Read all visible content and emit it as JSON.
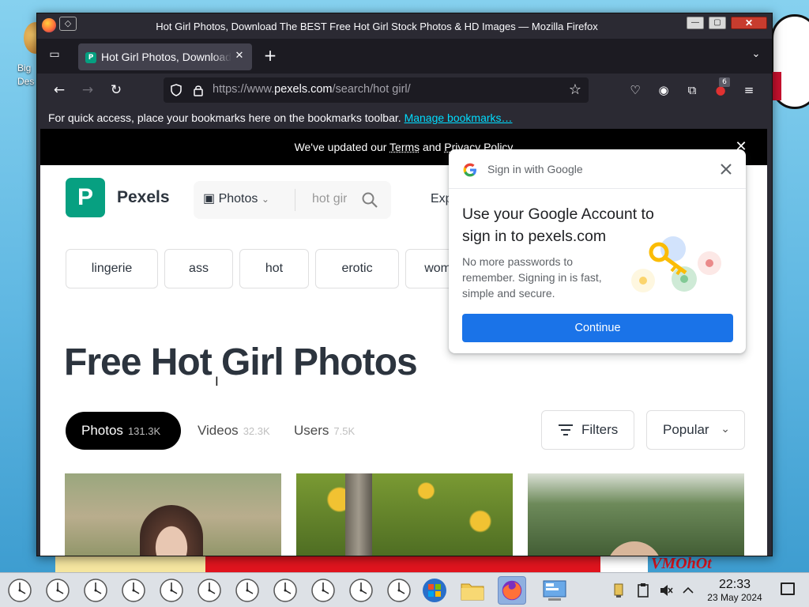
{
  "desktop": {
    "icon_label": "Big Des",
    "brand_text": "VMOhOt"
  },
  "window": {
    "title": "Hot Girl Photos, Download The BEST Free Hot Girl Stock Photos & HD Images — Mozilla Firefox",
    "buttons": {
      "minimize": "—",
      "maximize": "▢",
      "close": "✕"
    }
  },
  "tabs": [
    {
      "title": "Hot Girl Photos, Download The BEST Free",
      "favicon": "P"
    }
  ],
  "toolbar": {
    "url_prefix": "https://www.",
    "url_host": "pexels.com",
    "url_path": "/search/hot girl/",
    "extension_badge": "6"
  },
  "bookmarks_bar": {
    "message": "For quick access, place your bookmarks here on the bookmarks toolbar.",
    "link": "Manage bookmarks…"
  },
  "notice": {
    "prefix": "We've updated our ",
    "terms": "Terms",
    "and": " and ",
    "privacy": "Privacy Policy"
  },
  "site": {
    "logo_letter": "P",
    "logo_text": "Pexels",
    "search_type": "Photos",
    "search_query": "hot girl",
    "explore": "Explore"
  },
  "chips": [
    "lingerie",
    "ass",
    "hot",
    "erotic",
    "women"
  ],
  "heading": "Free Hot Girl Photos",
  "result_tabs": [
    {
      "label": "Photos",
      "count": "131.3K",
      "active": true
    },
    {
      "label": "Videos",
      "count": "32.3K",
      "active": false
    },
    {
      "label": "Users",
      "count": "7.5K",
      "active": false
    }
  ],
  "filters_label": "Filters",
  "sort_label": "Popular",
  "google_signin": {
    "header": "Sign in with Google",
    "title": "Use your Google Account to sign in to pexels.com",
    "description": "No more passwords to remember. Signing in is fast, simple and secure.",
    "button": "Continue",
    "button_color": "#1a73e8"
  },
  "taskbar": {
    "time": "22:33",
    "date": "23 May 2024",
    "clock_count": 11
  },
  "colors": {
    "pexels_green": "#07a081",
    "firefox_dark": "#2b2a33",
    "link_cyan": "#00ddff"
  }
}
